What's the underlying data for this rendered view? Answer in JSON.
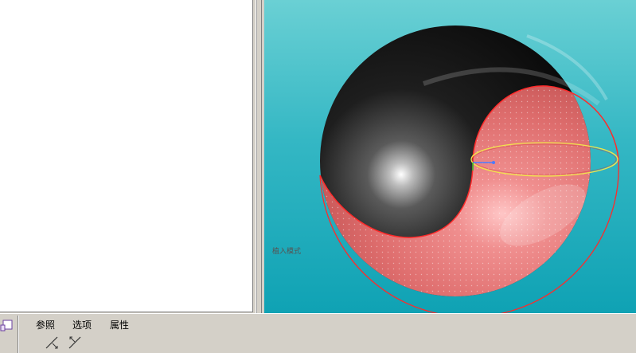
{
  "viewport": {
    "mode_label": "植入模式",
    "background_top": "#6ad0d4",
    "background_bottom": "#0fa2b4"
  },
  "dashboard": {
    "tabs": [
      {
        "label": "参照"
      },
      {
        "label": "选项"
      },
      {
        "label": "属性"
      }
    ],
    "tools": [
      {
        "icon": "arrow-down-right-icon"
      },
      {
        "icon": "arrow-up-left-icon"
      }
    ]
  },
  "colors": {
    "black_surface": "#111111",
    "pink_surface": "#e87878",
    "highlight_edge": "#ff2020",
    "ring": "#f0e040"
  }
}
